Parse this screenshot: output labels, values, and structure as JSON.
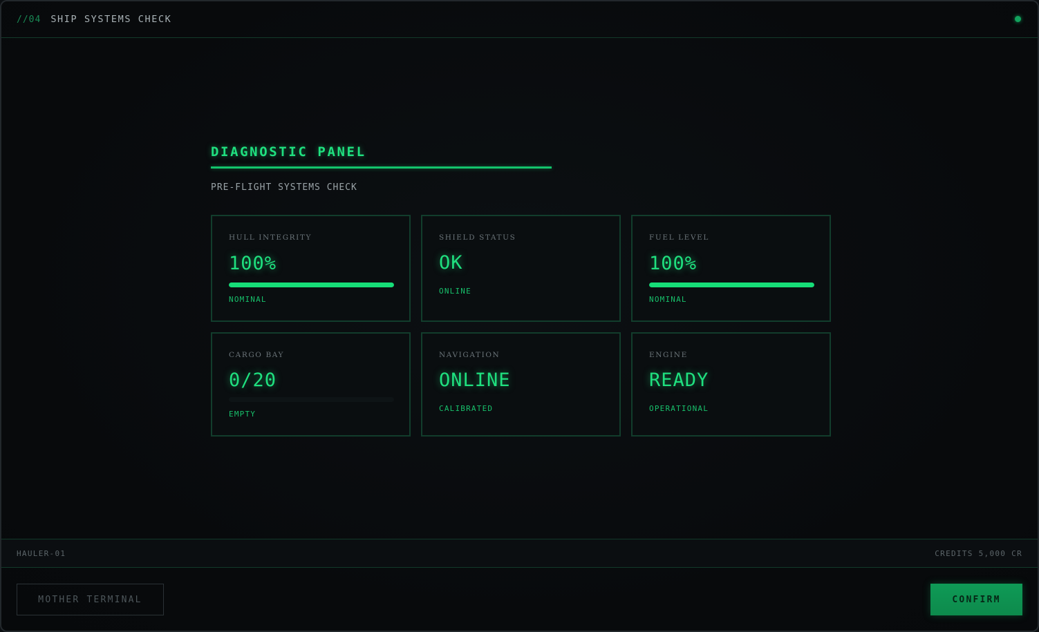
{
  "header": {
    "step": "//04",
    "title": "SHIP SYSTEMS CHECK"
  },
  "panel": {
    "title": "DIAGNOSTIC PANEL",
    "subtitle": "PRE-FLIGHT SYSTEMS CHECK"
  },
  "cards": [
    {
      "label": "HULL INTEGRITY",
      "value": "100%",
      "state": "NOMINAL",
      "progress": 1.0
    },
    {
      "label": "SHIELD STATUS",
      "value": "OK",
      "state": "ONLINE"
    },
    {
      "label": "FUEL LEVEL",
      "value": "100%",
      "state": "NOMINAL",
      "progress": 1.0
    },
    {
      "label": "CARGO BAY",
      "value": "0/20",
      "state": "EMPTY",
      "progress": 0.0
    },
    {
      "label": "NAVIGATION",
      "value": "ONLINE",
      "state": "CALIBRATED"
    },
    {
      "label": "ENGINE",
      "value": "READY",
      "state": "OPERATIONAL"
    }
  ],
  "footer": {
    "ship_id": "HAULER-01",
    "credits": "CREDITS 5,000 CR",
    "mother_label": "MOTHER TERMINAL",
    "confirm_label": "CONFIRM"
  },
  "colors": {
    "accent": "#1fe07f",
    "button": "#0f9a56",
    "border": "#123d2c"
  }
}
